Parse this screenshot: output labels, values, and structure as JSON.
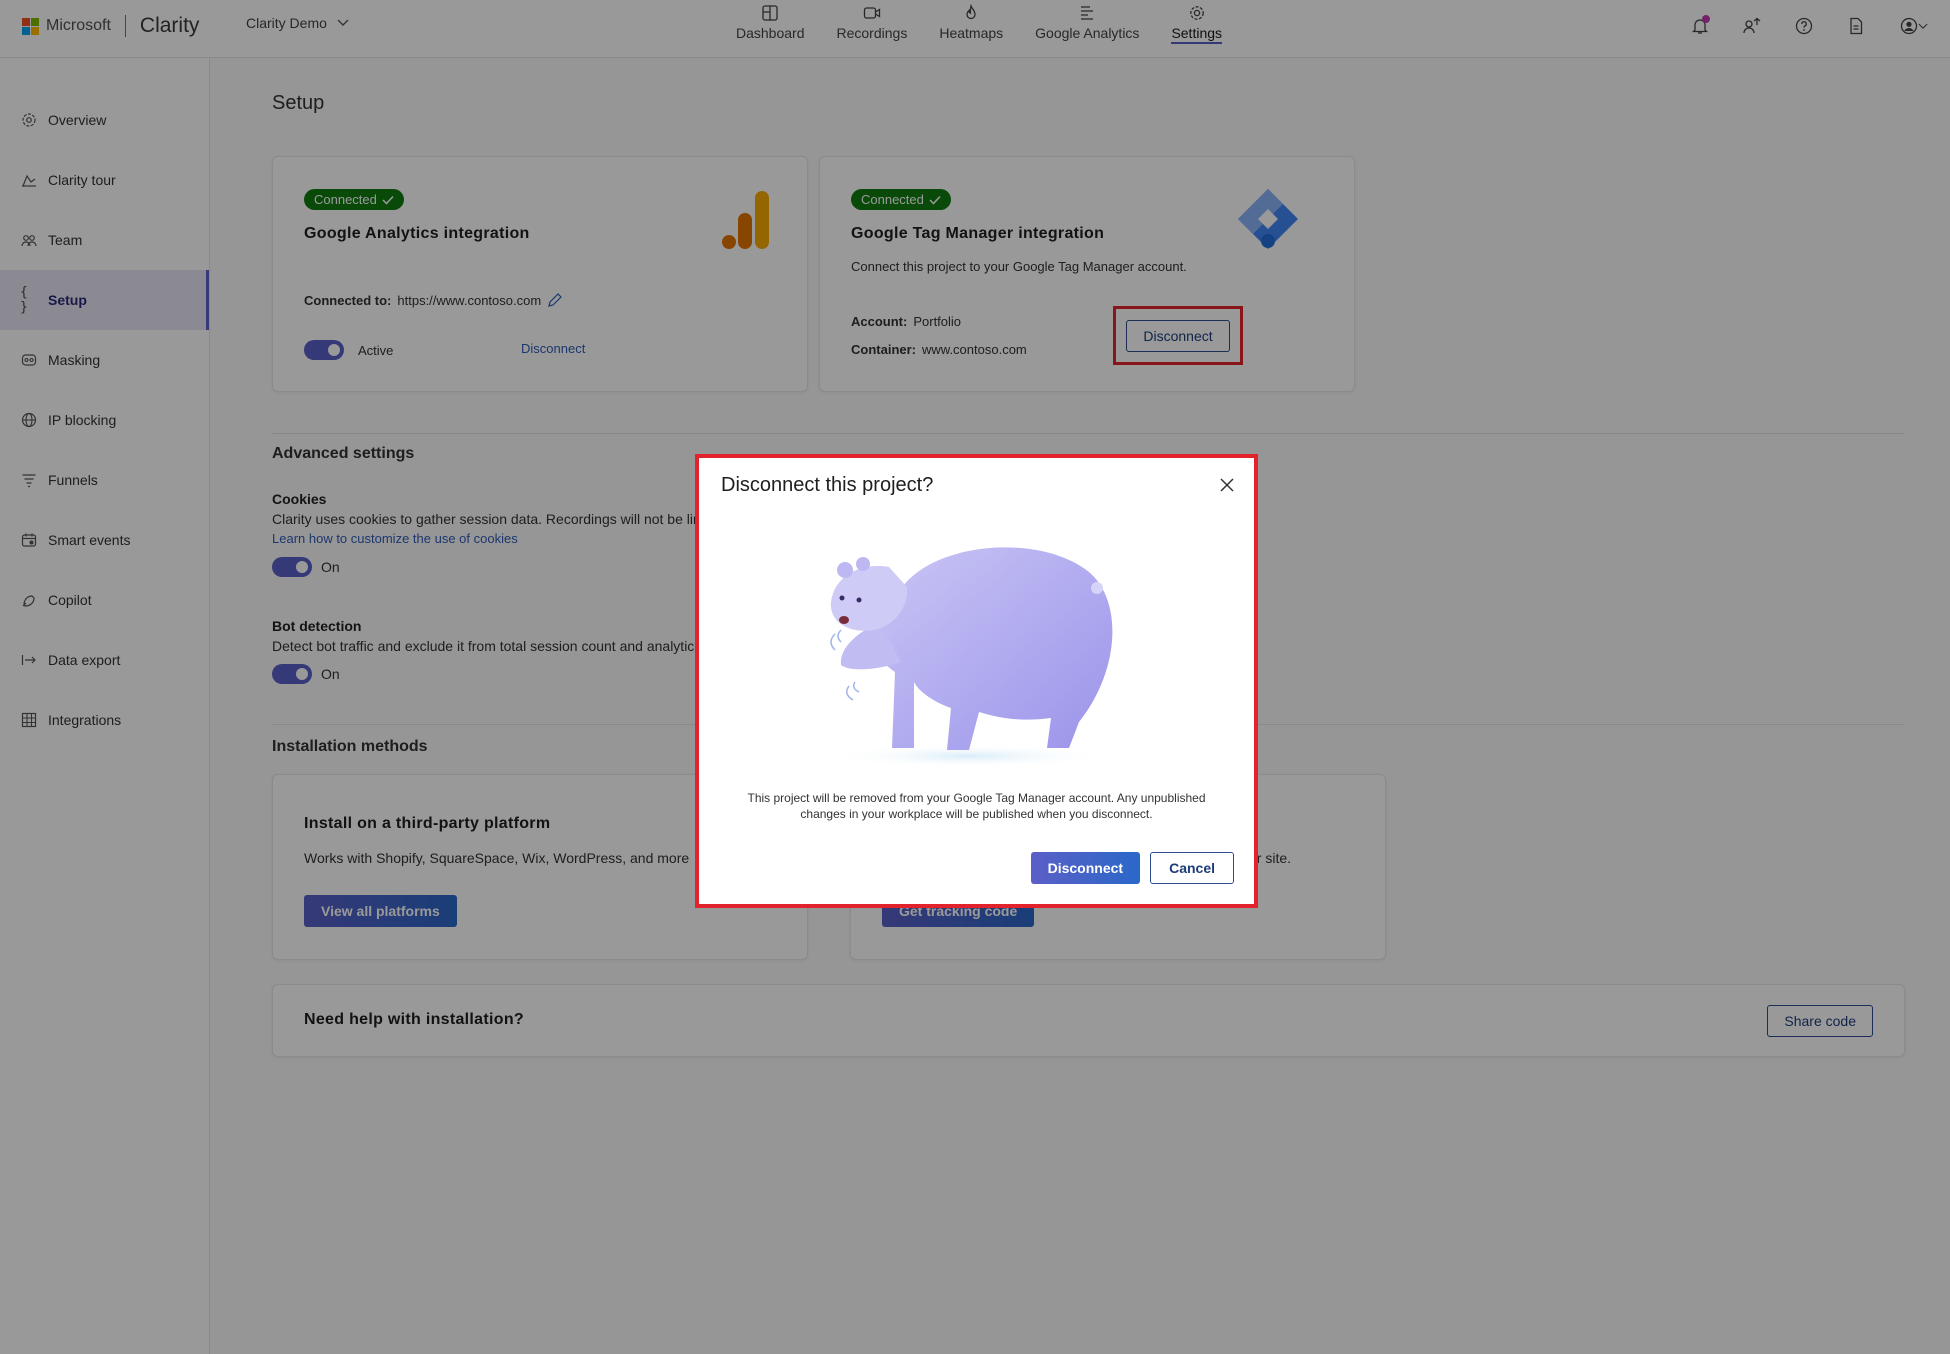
{
  "topbar": {
    "ms_label": "Microsoft",
    "app_name": "Clarity",
    "project": "Clarity Demo",
    "nav": [
      {
        "label": "Dashboard",
        "icon": "dashboard-icon"
      },
      {
        "label": "Recordings",
        "icon": "video-icon"
      },
      {
        "label": "Heatmaps",
        "icon": "flame-icon"
      },
      {
        "label": "Google Analytics",
        "icon": "analytics-icon"
      },
      {
        "label": "Settings",
        "icon": "gear-icon",
        "active": true
      }
    ]
  },
  "sidebar": {
    "items": [
      {
        "label": "Overview",
        "icon": "gear-icon"
      },
      {
        "label": "Clarity tour",
        "icon": "tour-icon"
      },
      {
        "label": "Team",
        "icon": "team-icon"
      },
      {
        "label": "Setup",
        "icon": "braces-icon",
        "active": true
      },
      {
        "label": "Masking",
        "icon": "mask-icon"
      },
      {
        "label": "IP blocking",
        "icon": "globe-icon"
      },
      {
        "label": "Funnels",
        "icon": "funnel-icon"
      },
      {
        "label": "Smart events",
        "icon": "smart-events-icon"
      },
      {
        "label": "Copilot",
        "icon": "copilot-icon"
      },
      {
        "label": "Data export",
        "icon": "export-icon"
      },
      {
        "label": "Integrations",
        "icon": "grid-icon"
      }
    ]
  },
  "main": {
    "title": "Setup",
    "ga_card": {
      "badge": "Connected",
      "title": "Google Analytics integration",
      "connected_to_label": "Connected to:",
      "connected_to_value": "https://www.contoso.com",
      "toggle_label": "Active",
      "disconnect": "Disconnect"
    },
    "gtm_card": {
      "badge": "Connected",
      "title": "Google Tag Manager integration",
      "description": "Connect this project to your Google Tag Manager account.",
      "account_label": "Account:",
      "account_value": "Portfolio",
      "container_label": "Container:",
      "container_value": "www.contoso.com",
      "disconnect": "Disconnect"
    },
    "advanced": {
      "heading": "Advanced settings",
      "cookies_title": "Cookies",
      "cookies_desc": "Clarity uses cookies to gather session data. Recordings will not be lin",
      "cookies_link": "Learn how to customize the use of cookies",
      "cookies_state": "On",
      "bot_title": "Bot detection",
      "bot_desc": "Detect bot traffic and exclude it from total session count and analytic",
      "bot_state": "On"
    },
    "install": {
      "heading": "Installation methods",
      "third_party_title": "Install on a third-party platform",
      "third_party_desc": "Works with Shopify, SquareSpace, Wix, WordPress, and more",
      "third_party_btn": "View all platforms",
      "manual_desc_tail": "ur site.",
      "manual_btn": "Get tracking code",
      "help_title": "Need help with installation?",
      "share_btn": "Share code"
    }
  },
  "dialog": {
    "title": "Disconnect this project?",
    "message": "This project will be removed from your Google Tag Manager account. Any unpublished changes in your workplace will be published when you disconnect.",
    "confirm": "Disconnect",
    "cancel": "Cancel"
  },
  "colors": {
    "accent": "#5b5fc7",
    "connected": "#107c10",
    "highlight": "#e3232c"
  }
}
